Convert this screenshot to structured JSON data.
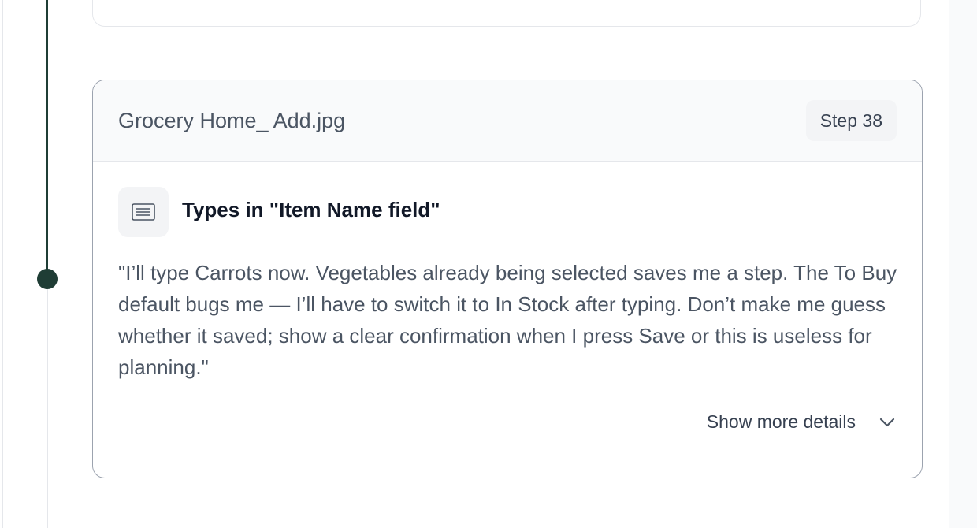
{
  "step": {
    "title": "Grocery Home_ Add.jpg",
    "badge": "Step 38",
    "action": {
      "icon": "keyboard-icon",
      "title": "Types in \"Item Name field\""
    },
    "quote": "\"I’ll type Carrots now. Vegetables already being selected saves me a step. The To Buy default bugs me — I’ll have to switch it to In Stock after typing. Don’t make me guess whether it saved; show a clear confirmation when I press Save or this is useless for planning.\"",
    "show_more_label": "Show more details",
    "show_more_icon": "chevron-down-icon"
  },
  "colors": {
    "timeline": "#1f3d35",
    "card_border": "#9ca3af",
    "header_bg": "#f9fafb",
    "text_muted": "#4b5563"
  }
}
